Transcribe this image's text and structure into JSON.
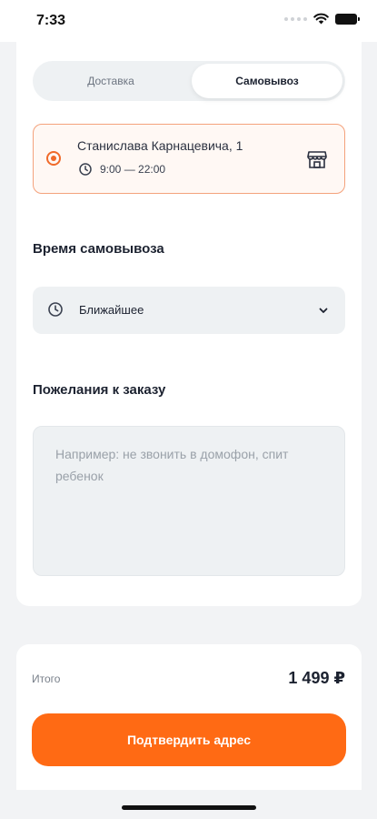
{
  "status_bar": {
    "time": "7:33"
  },
  "delivery_tabs": [
    {
      "label": "Доставка",
      "selected": false
    },
    {
      "label": "Самовывоз",
      "selected": true
    }
  ],
  "pickup_point": {
    "address": "Станислава Карнацевича, 1",
    "hours": "9:00 — 22:00",
    "icon": "store-icon"
  },
  "pickup_time": {
    "title": "Время самовывоза",
    "value": "Ближайшее"
  },
  "order_wishes": {
    "title": "Пожелания к заказу",
    "placeholder": "Например: не звонить в домофон, спит ребенок",
    "value": ""
  },
  "summary": {
    "total_label": "Итого",
    "total_value": "1 499 ₽",
    "confirm_label": "Подтвердить адрес"
  },
  "colors": {
    "accent": "#ff6a14",
    "selected_border": "#f4a27c",
    "field_bg": "#eef1f3"
  }
}
